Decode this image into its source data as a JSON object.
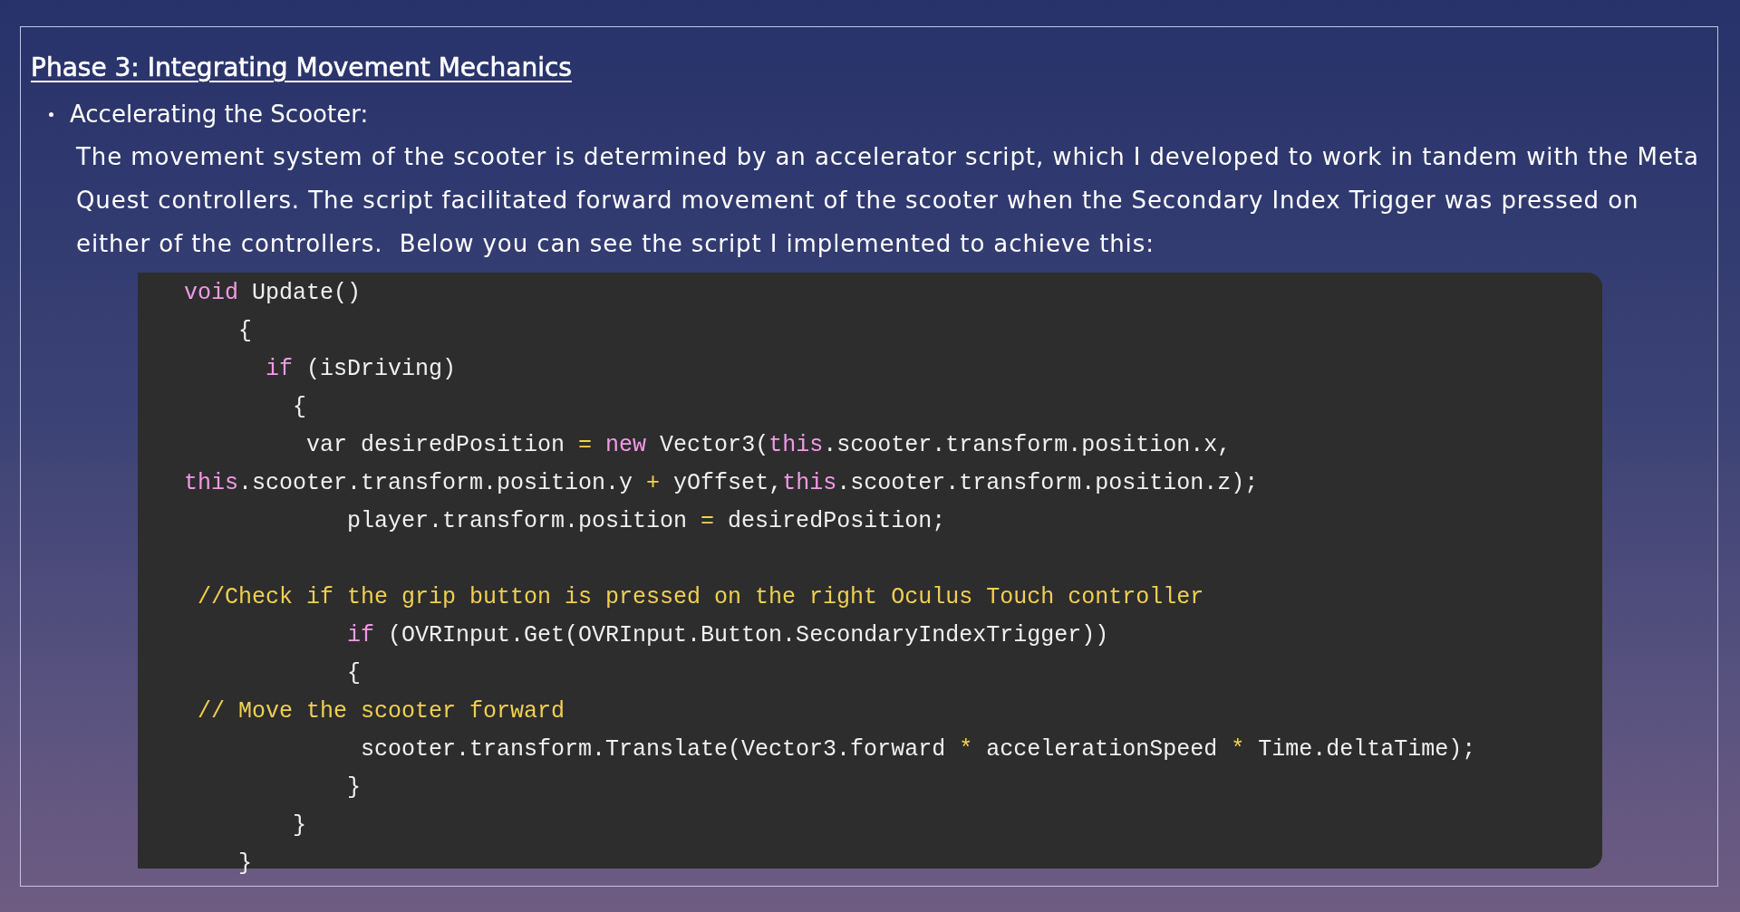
{
  "section": {
    "heading": "Phase 3: Integrating Movement Mechanics",
    "items": [
      {
        "title": "Accelerating the Scooter:",
        "body": "The movement system of the scooter is determined by an accelerator script, which I developed to work in tandem with the Meta Quest controllers. The script facilitated forward movement of the scooter when the Secondary Index Trigger was pressed on either of the controllers.  Below you can see the script I implemented to achieve this:",
        "code": [
          {
            "kind": "code",
            "tokens": [
              {
                "text": "void",
                "kind": "keyword"
              },
              {
                "text": " Update()",
                "kind": "plain"
              }
            ]
          },
          {
            "kind": "code",
            "tokens": [
              {
                "text": "    {",
                "kind": "plain"
              }
            ]
          },
          {
            "kind": "code",
            "tokens": [
              {
                "text": "      if",
                "kind": "keyword"
              },
              {
                "text": " (isDriving)",
                "kind": "plain"
              }
            ]
          },
          {
            "kind": "code",
            "tokens": [
              {
                "text": "        {",
                "kind": "plain"
              }
            ]
          },
          {
            "kind": "code",
            "tokens": [
              {
                "text": "         var desiredPosition ",
                "kind": "plain"
              },
              {
                "text": "=",
                "kind": "operator"
              },
              {
                "text": " new",
                "kind": "keyword"
              },
              {
                "text": " Vector3(",
                "kind": "plain"
              },
              {
                "text": "this",
                "kind": "keyword"
              },
              {
                "text": ".scooter.transform.position.x,",
                "kind": "plain"
              }
            ]
          },
          {
            "kind": "code",
            "tokens": [
              {
                "text": "this",
                "kind": "keyword"
              },
              {
                "text": ".scooter.transform.position.y ",
                "kind": "plain"
              },
              {
                "text": "+",
                "kind": "operator"
              },
              {
                "text": " yOffset,",
                "kind": "plain"
              },
              {
                "text": "this",
                "kind": "keyword"
              },
              {
                "text": ".scooter.transform.position.z);",
                "kind": "plain"
              }
            ]
          },
          {
            "kind": "code",
            "tokens": [
              {
                "text": "            player.transform.position ",
                "kind": "plain"
              },
              {
                "text": "=",
                "kind": "operator"
              },
              {
                "text": " desiredPosition;",
                "kind": "plain"
              }
            ]
          },
          {
            "kind": "blank"
          },
          {
            "kind": "code",
            "tokens": [
              {
                "text": " //Check if the grip button is pressed on the right Oculus Touch controller",
                "kind": "comment"
              }
            ]
          },
          {
            "kind": "code",
            "tokens": [
              {
                "text": "            if",
                "kind": "keyword"
              },
              {
                "text": " (OVRInput.Get(OVRInput.Button.SecondaryIndexTrigger))",
                "kind": "plain"
              }
            ]
          },
          {
            "kind": "code",
            "tokens": [
              {
                "text": "            {",
                "kind": "plain"
              }
            ]
          },
          {
            "kind": "code",
            "tokens": [
              {
                "text": " // Move the scooter forward",
                "kind": "comment"
              }
            ]
          },
          {
            "kind": "code",
            "tokens": [
              {
                "text": "             scooter.transform.Translate(Vector3.forward ",
                "kind": "plain"
              },
              {
                "text": "*",
                "kind": "operator"
              },
              {
                "text": " accelerationSpeed ",
                "kind": "plain"
              },
              {
                "text": "*",
                "kind": "operator"
              },
              {
                "text": " Time.deltaTime);",
                "kind": "plain"
              }
            ]
          },
          {
            "kind": "code",
            "tokens": [
              {
                "text": "            }",
                "kind": "plain"
              }
            ]
          },
          {
            "kind": "code",
            "tokens": [
              {
                "text": "        }",
                "kind": "plain"
              }
            ]
          },
          {
            "kind": "code",
            "tokens": [
              {
                "text": "    }",
                "kind": "plain"
              }
            ]
          }
        ]
      }
    ]
  }
}
